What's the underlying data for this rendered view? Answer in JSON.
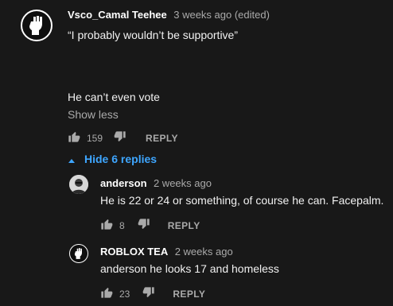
{
  "comment": {
    "author": "Vsco_Camal Teehee",
    "time": "3 weeks ago (edited)",
    "line1": "“I probably wouldn’t be supportive”",
    "line2": "He can’t even vote",
    "show_less": "Show less",
    "likes": "159",
    "reply_label": "REPLY",
    "avatar_icon": "raised-fist-icon"
  },
  "hide_replies": "Hide 6 replies",
  "replies": [
    {
      "author": "anderson",
      "time": "2 weeks ago",
      "text": "He is 22 or 24 or something, of course he can. Facepalm.",
      "likes": "8",
      "reply_label": "REPLY",
      "avatar_icon": "person-photo-icon"
    },
    {
      "author": "ROBLOX TEA",
      "time": "2 weeks ago",
      "text": "anderson he looks 17 and homeless",
      "likes": "23",
      "reply_label": "REPLY",
      "avatar_icon": "raised-fist-icon"
    }
  ],
  "colors": {
    "background": "#181818",
    "link": "#3ea6ff",
    "muted": "#aaaaaa"
  }
}
